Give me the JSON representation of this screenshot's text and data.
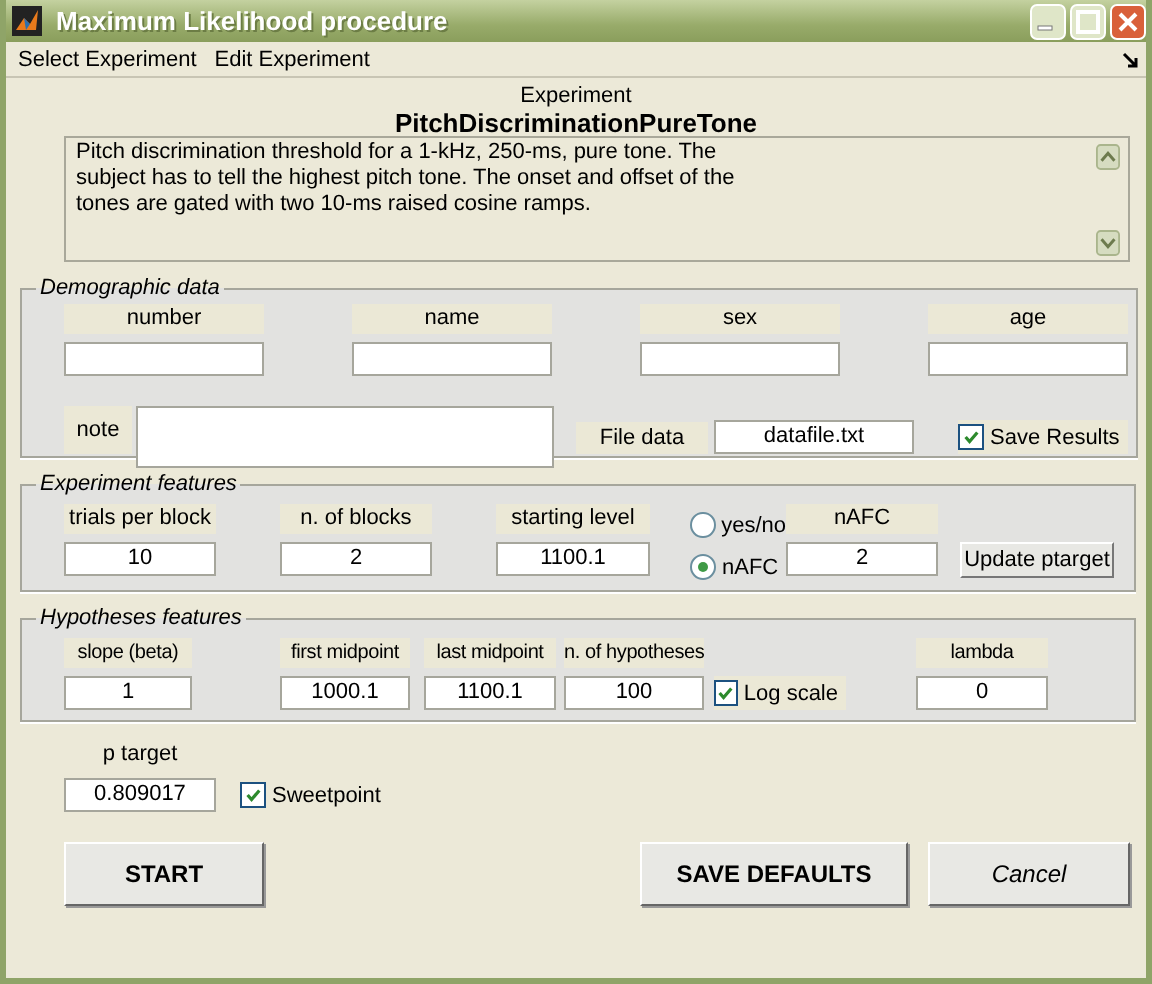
{
  "window": {
    "title": "Maximum Likelihood procedure"
  },
  "menu": [
    {
      "label": "Select Experiment"
    },
    {
      "label": "Edit Experiment"
    }
  ],
  "experiment": {
    "caption": "Experiment",
    "name": "PitchDiscriminationPureTone",
    "description": [
      "Pitch discrimination threshold for a 1-kHz, 250-ms, pure tone. The",
      "subject has to tell the highest pitch tone. The onset and offset of the",
      "tones are gated with two 10-ms raised cosine ramps."
    ]
  },
  "panels": [
    {
      "title": "Demographic data",
      "items": [
        {
          "kind": "field",
          "label": "number"
        },
        {
          "kind": "field",
          "label": "name"
        },
        {
          "kind": "field",
          "label": "sex"
        },
        {
          "kind": "field",
          "label": "age"
        },
        {
          "kind": "note",
          "label": "note"
        },
        {
          "kind": "inline_field",
          "label": "File data",
          "value": "datafile.txt"
        },
        {
          "kind": "checkbox",
          "label": "Save Results",
          "checked": true
        }
      ]
    },
    {
      "title": "Experiment features",
      "items": [
        {
          "kind": "field",
          "label": "trials per block",
          "value": "10"
        },
        {
          "kind": "field",
          "label": "n. of blocks",
          "value": "2"
        },
        {
          "kind": "field",
          "label": "starting level",
          "value": "1100.1"
        },
        {
          "kind": "radios",
          "options": [
            {
              "label": "yes/no",
              "selected": false
            },
            {
              "label": "nAFC",
              "selected": true
            }
          ]
        },
        {
          "kind": "field",
          "label": "nAFC",
          "value": "2"
        },
        {
          "kind": "button",
          "label": "Update ptarget"
        }
      ]
    },
    {
      "title": "Hypotheses features",
      "items": [
        {
          "kind": "field",
          "label": "slope (beta)",
          "value": "1"
        },
        {
          "kind": "field",
          "label": "first midpoint",
          "value": "1000.1"
        },
        {
          "kind": "field",
          "label": "last midpoint",
          "value": "1100.1"
        },
        {
          "kind": "field",
          "label": "n. of hypotheses",
          "value": "100"
        },
        {
          "kind": "checkbox",
          "label": "Log scale",
          "checked": true
        },
        {
          "kind": "field",
          "label": "lambda",
          "value": "0"
        }
      ]
    }
  ],
  "target": [
    {
      "kind": "field",
      "label": "p target",
      "value": "0.809017"
    },
    {
      "kind": "checkbox",
      "label": "Sweetpoint",
      "checked": true
    }
  ],
  "buttons": [
    {
      "label": "START",
      "kind": "action"
    },
    {
      "label": "SAVE DEFAULTS",
      "kind": "action"
    },
    {
      "label": "Cancel",
      "kind": "cancel"
    }
  ]
}
